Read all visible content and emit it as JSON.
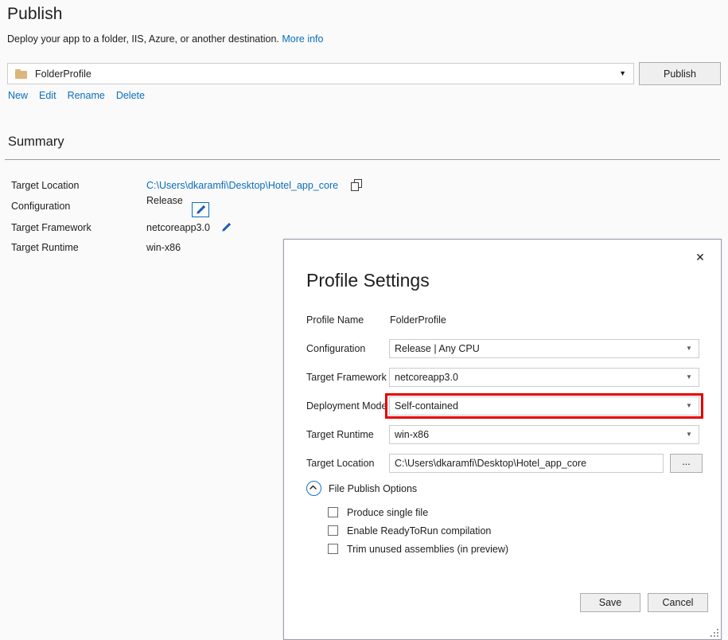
{
  "page": {
    "title": "Publish",
    "subtitle": "Deploy your app to a folder, IIS, Azure, or another destination.",
    "more_info_label": "More info",
    "publish_button_label": "Publish",
    "profile_selected": "FolderProfile",
    "profile_icon": "folder-icon",
    "dropdown_arrow": "chevron-down-icon",
    "actions": [
      {
        "label": "New"
      },
      {
        "label": "Edit"
      },
      {
        "label": "Rename"
      },
      {
        "label": "Delete"
      }
    ],
    "summary": {
      "heading": "Summary",
      "rows": [
        {
          "label": "Target Location",
          "value": "C:\\Users\\dkaramfi\\Desktop\\Hotel_app_core",
          "icon": "copy-icon"
        },
        {
          "label": "Configuration",
          "value": "Release",
          "icon": "pencil-icon"
        },
        {
          "label": "Target Framework",
          "value": "netcoreapp3.0",
          "icon": "pencil-icon"
        },
        {
          "label": "Target Runtime",
          "value": "win-x86",
          "icon": ""
        }
      ]
    }
  },
  "dialog": {
    "title": "Profile Settings",
    "close_label": "✕",
    "fields": {
      "profile_name_label": "Profile Name",
      "profile_name_value": "FolderProfile",
      "configuration_label": "Configuration",
      "configuration_value": "Release | Any CPU",
      "target_framework_label": "Target Framework",
      "target_framework_value": "netcoreapp3.0",
      "deployment_mode_label": "Deployment Mode",
      "deployment_mode_value": "Self-contained",
      "target_runtime_label": "Target Runtime",
      "target_runtime_value": "win-x86",
      "target_location_label": "Target Location",
      "target_location_value": "C:\\Users\\dkaramfi\\Desktop\\Hotel_app_core",
      "browse_label": "..."
    },
    "file_publish_options": {
      "section_label": "File Publish Options",
      "expander_icon": "chevron-up-circle-icon",
      "options": [
        {
          "label": "Produce single file",
          "checked": false
        },
        {
          "label": "Enable ReadyToRun compilation",
          "checked": false
        },
        {
          "label": "Trim unused assemblies (in preview)",
          "checked": false
        }
      ]
    },
    "buttons": {
      "save_label": "Save",
      "cancel_label": "Cancel"
    },
    "highlight_color": "#e50000"
  }
}
